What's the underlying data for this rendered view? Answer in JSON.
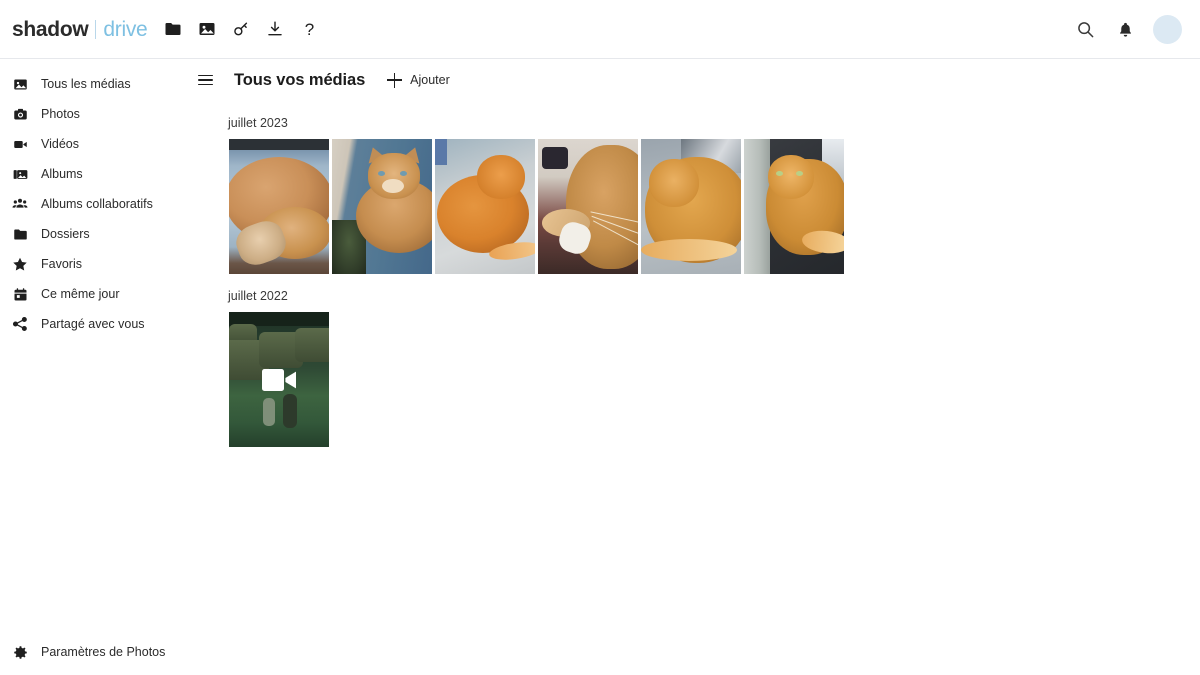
{
  "brand": {
    "primary": "shadow",
    "secondary": "drive"
  },
  "topbar": {
    "nav": [
      {
        "name": "folder-icon",
        "label": "Dossiers"
      },
      {
        "name": "image-icon",
        "label": "Photos"
      },
      {
        "name": "key-icon",
        "label": "Clés"
      },
      {
        "name": "download-icon",
        "label": "Téléchargements"
      },
      {
        "name": "help-icon",
        "label": "?"
      }
    ],
    "search_label": "Rechercher",
    "notifications_label": "Notifications",
    "avatar_label": "Compte",
    "avatar_color": "#dce9f3"
  },
  "sidebar": {
    "items": [
      {
        "icon": "all-media-icon",
        "label": "Tous les médias"
      },
      {
        "icon": "camera-icon",
        "label": "Photos"
      },
      {
        "icon": "video-camera-icon",
        "label": "Vidéos"
      },
      {
        "icon": "albums-icon",
        "label": "Albums"
      },
      {
        "icon": "people-group-icon",
        "label": "Albums collaboratifs"
      },
      {
        "icon": "folder-icon",
        "label": "Dossiers"
      },
      {
        "icon": "star-icon",
        "label": "Favoris"
      },
      {
        "icon": "calendar-icon",
        "label": "Ce même jour"
      },
      {
        "icon": "share-icon",
        "label": "Partagé avec vous"
      }
    ],
    "footer": {
      "icon": "gear-icon",
      "label": "Paramètres de Photos"
    }
  },
  "main": {
    "menu_label": "Menu",
    "title": "Tous vos médias",
    "add_label": "Ajouter",
    "groups": [
      {
        "label": "juillet 2023",
        "items": [
          {
            "alt": "Chat roux endormi en boule sur une serviette bleue",
            "type": "photo",
            "style": "t1"
          },
          {
            "alt": "Chat roux à poils longs assis sur un fauteuil bleu",
            "type": "photo",
            "style": "t2"
          },
          {
            "alt": "Chaton roux couché sur une surface grise",
            "type": "photo",
            "style": "t3"
          },
          {
            "alt": "Chat roux endormi sur un tissu rouge",
            "type": "photo",
            "style": "t4"
          },
          {
            "alt": "Chat roux allongé sur un siège de voiture gris",
            "type": "photo",
            "style": "t5"
          },
          {
            "alt": "Chat roux allongé sur un siège de voiture sombre",
            "type": "photo",
            "style": "t6"
          }
        ]
      },
      {
        "label": "juillet 2022",
        "items": [
          {
            "alt": "Vidéo : chats dans un champ près de balles de foin",
            "type": "video",
            "style": "tv"
          }
        ]
      }
    ]
  }
}
